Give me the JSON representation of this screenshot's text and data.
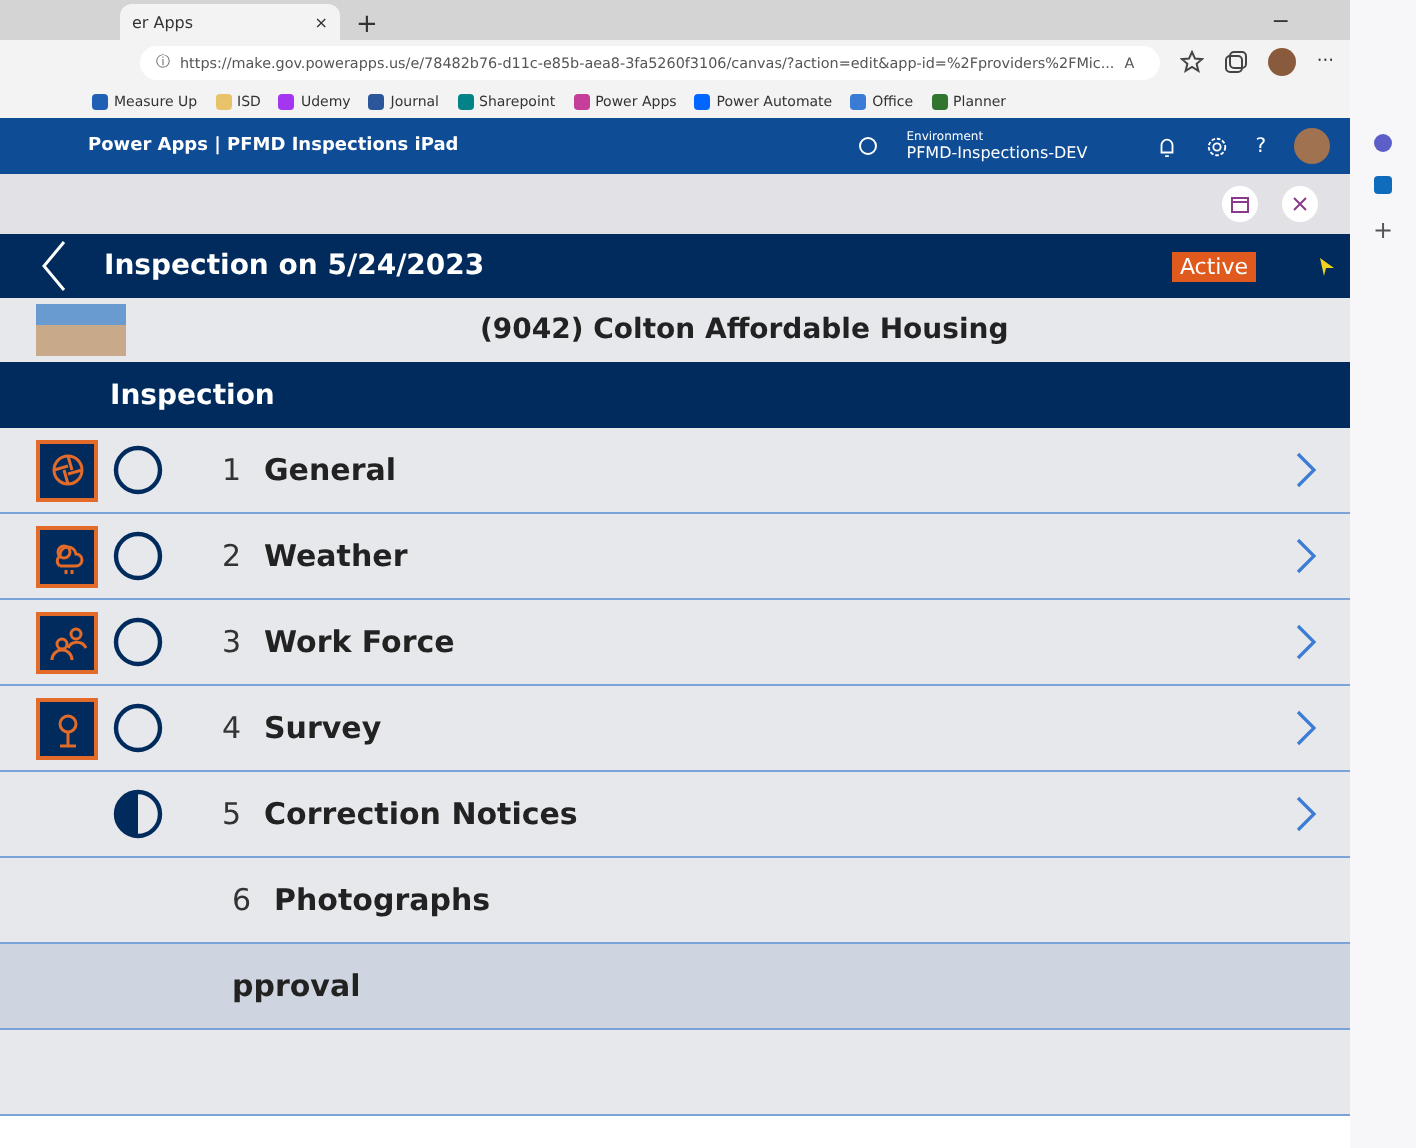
{
  "browser": {
    "tab_title": "er Apps",
    "close_tab": "×",
    "info": "ⓘ",
    "new_tab": "+",
    "minimize": "−",
    "url": "https://make.gov.powerapps.us/e/78482b76-d11c-e85b-aea8-3fa5260f3106/canvas/?action=edit&app-id=%2Fproviders%2FMic...",
    "read_aloud": "A",
    "more": "···",
    "bookmarks": [
      {
        "label": "Measure Up",
        "color": "#1f5fb4"
      },
      {
        "label": "ISD",
        "color": "#e8c36a"
      },
      {
        "label": "Udemy",
        "color": "#a435f0"
      },
      {
        "label": "Journal",
        "color": "#2b579a"
      },
      {
        "label": "Sharepoint",
        "color": "#038387"
      },
      {
        "label": "Power Apps",
        "color": "#c43e9a"
      },
      {
        "label": "Power Automate",
        "color": "#0066ff"
      },
      {
        "label": "Office",
        "color": "#3a7bd5"
      },
      {
        "label": "Planner",
        "color": "#31752f"
      }
    ]
  },
  "app_header": {
    "title": "Power Apps  |  PFMD Inspections iPad",
    "environment_label": "Environment",
    "environment": "PFMD-Inspections-DEV",
    "help": "?"
  },
  "screen": {
    "title": "Inspection on 5/24/2023",
    "status": "Active",
    "property": "(9042)  Colton Affordable Housing",
    "section": "Inspection",
    "rows": [
      {
        "kind": "pending",
        "number": "1",
        "label": "General",
        "chevron": true
      },
      {
        "kind": "pending",
        "number": "2",
        "label": "Weather",
        "chevron": true
      },
      {
        "kind": "pending",
        "number": "3",
        "label": "Work Force",
        "chevron": true
      },
      {
        "kind": "pending",
        "number": "4",
        "label": "Survey",
        "chevron": true
      },
      {
        "kind": "partial",
        "number": "5",
        "label": "Correction Notices",
        "chevron": true
      },
      {
        "kind": "plain",
        "number": "6",
        "label": "Photographs",
        "chevron": false
      }
    ],
    "subsection": "pproval"
  },
  "side_panel": {
    "add": "+"
  }
}
